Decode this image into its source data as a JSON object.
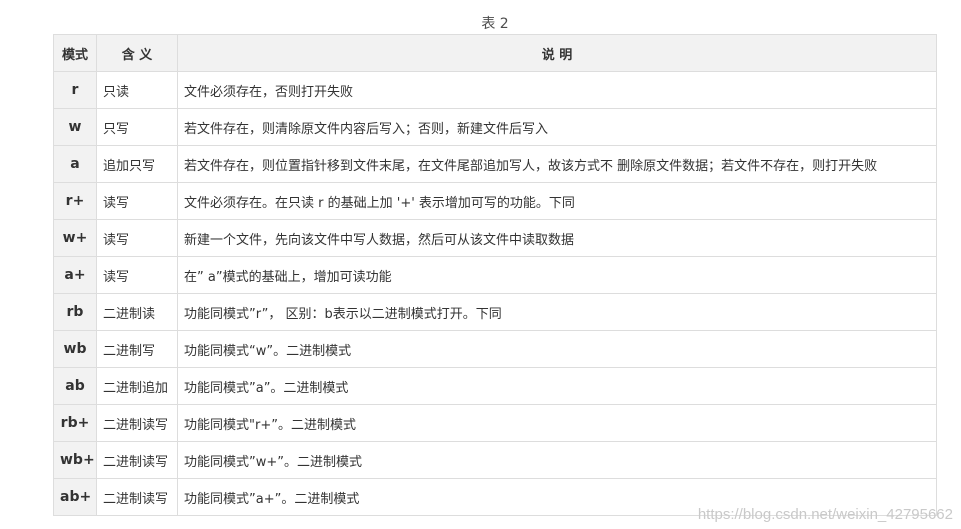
{
  "caption": "表 2",
  "table": {
    "headers": {
      "mode": "模式",
      "meaning": "含 义",
      "desc": "说 明"
    },
    "rows": [
      {
        "mode": "r",
        "meaning": "只读",
        "desc": "文件必须存在，否则打开失败"
      },
      {
        "mode": "w",
        "meaning": "只写",
        "desc": "若文件存在，则清除原文件内容后写入；否则，新建文件后写入"
      },
      {
        "mode": "a",
        "meaning": "追加只写",
        "desc": "若文件存在，则位置指针移到文件末尾，在文件尾部追加写人，故该方式不 删除原文件数据；若文件不存在，则打开失败"
      },
      {
        "mode": "r+",
        "meaning": "读写",
        "desc": "文件必须存在。在只读 r 的基础上加 '+' 表示增加可写的功能。下同"
      },
      {
        "mode": "w+",
        "meaning": "读写",
        "desc": "新建一个文件，先向该文件中写人数据，然后可从该文件中读取数据"
      },
      {
        "mode": "a+",
        "meaning": "读写",
        "desc": "在” a”模式的基础上，增加可读功能"
      },
      {
        "mode": "rb",
        "meaning": "二进制读",
        "desc": "功能同模式”r”， 区别：b表示以二进制模式打开。下同"
      },
      {
        "mode": "wb",
        "meaning": "二进制写",
        "desc": "功能同模式“w”。二进制模式"
      },
      {
        "mode": "ab",
        "meaning": "二进制追加",
        "desc": "功能同模式”a”。二进制模式"
      },
      {
        "mode": "rb+",
        "meaning": "二进制读写",
        "desc": "功能同模式\"r+”。二进制模式"
      },
      {
        "mode": "wb+",
        "meaning": "二进制读写",
        "desc": "功能同模式”w+”。二进制模式"
      },
      {
        "mode": "ab+",
        "meaning": "二进制读写",
        "desc": "功能同模式”a+”。二进制模式"
      }
    ]
  },
  "watermark": "https://blog.csdn.net/weixin_42795662"
}
